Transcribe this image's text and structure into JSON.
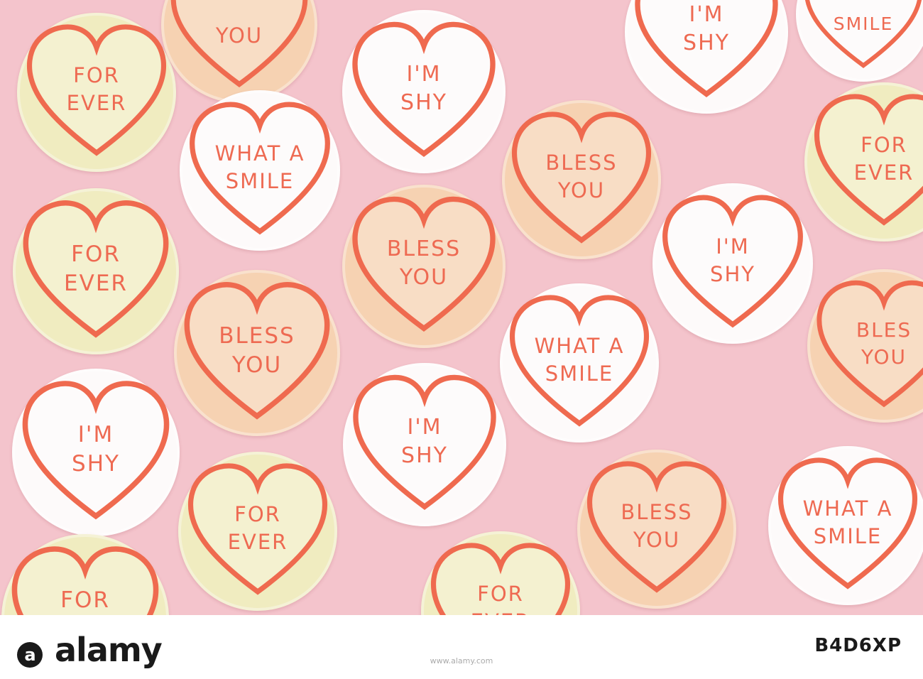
{
  "image": {
    "background_color": "#f4c4cc",
    "heart_outline_color": "#ef6a4f",
    "text_color": "#ee6a52",
    "candies": [
      {
        "color": "#f0ecc0",
        "line1": "FOR",
        "line2": "EVER"
      },
      {
        "color": "#f6d2b2",
        "line1": "",
        "line2": "YOU"
      },
      {
        "color": "#fdfafa",
        "line1": "I'M",
        "line2": "SHY"
      },
      {
        "color": "#fdfafa",
        "line1": "I'M",
        "line2": "SHY"
      },
      {
        "color": "#fdfafa",
        "line1": "",
        "line2": "SMILE"
      },
      {
        "color": "#fdfafa",
        "line1": "WHAT A",
        "line2": "SMILE"
      },
      {
        "color": "#f6d2b2",
        "line1": "BLESS",
        "line2": "YOU"
      },
      {
        "color": "#f0ecc0",
        "line1": "FOR",
        "line2": "EVER"
      },
      {
        "color": "#f6d2b2",
        "line1": "BLESS",
        "line2": "YOU"
      },
      {
        "color": "#f0ecc0",
        "line1": "FOR",
        "line2": "EVER"
      },
      {
        "color": "#fdfafa",
        "line1": "I'M",
        "line2": "SHY"
      },
      {
        "color": "#f6d2b2",
        "line1": "BLESS",
        "line2": "YOU"
      },
      {
        "color": "#fdfafa",
        "line1": "WHAT A",
        "line2": "SMILE"
      },
      {
        "color": "#f6d2b2",
        "line1": "BLES",
        "line2": "YOU"
      },
      {
        "color": "#fdfafa",
        "line1": "I'M",
        "line2": "SHY"
      },
      {
        "color": "#fdfafa",
        "line1": "I'M",
        "line2": "SHY"
      },
      {
        "color": "#f0ecc0",
        "line1": "FOR",
        "line2": "EVER"
      },
      {
        "color": "#f6d2b2",
        "line1": "BLESS",
        "line2": "YOU"
      },
      {
        "color": "#fdfafa",
        "line1": "WHAT A",
        "line2": "SMILE"
      },
      {
        "color": "#f0ecc0",
        "line1": "FOR",
        "line2": ""
      },
      {
        "color": "#f0ecc0",
        "line1": "FOR",
        "line2": "EVER"
      }
    ]
  },
  "watermark": {
    "brand": "alamy",
    "image_code": "B4D6XP",
    "url": "www.alamy.com"
  }
}
